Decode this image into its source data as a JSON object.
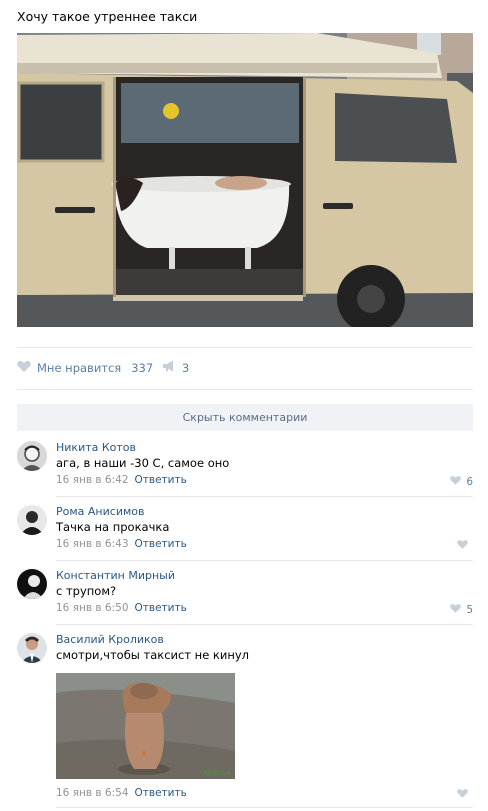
{
  "post": {
    "text": "Хочу такое утреннее такси"
  },
  "actions": {
    "like_label": "Мне нравится",
    "like_count": "337",
    "share_count": "3"
  },
  "hide_comments_label": "Скрыть комментарии",
  "comments": [
    {
      "author": "Никита Котов",
      "text": "ага, в наши -30 С, самое оно",
      "date": "16 янв в 6:42",
      "reply": "Ответить",
      "likes": "6"
    },
    {
      "author": "Рома Анисимов",
      "text": "Тачка на прокачка",
      "date": "16 янв в 6:43",
      "reply": "Ответить",
      "likes": ""
    },
    {
      "author": "Константин Мирный",
      "text": "с трупом?",
      "date": "16 янв в 6:50",
      "reply": "Ответить",
      "likes": "5"
    },
    {
      "author": "Василий Кроликов",
      "text": "смотри,чтобы таксист не кинул",
      "date": "16 янв в 6:54",
      "reply": "Ответить",
      "likes": ""
    }
  ],
  "attachment_watermark": "fishki.net",
  "colors": {
    "link": "#2a5885",
    "action": "#5a7fa6",
    "meta": "#939393",
    "divider": "#e7e8ec",
    "button_bg": "#f0f2f5"
  }
}
